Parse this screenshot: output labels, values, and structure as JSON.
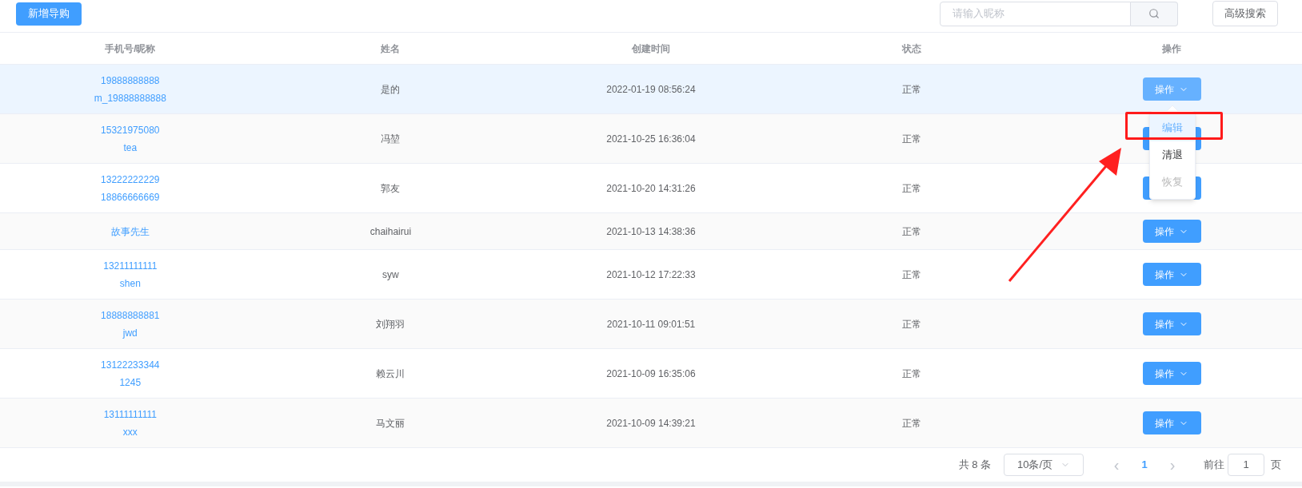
{
  "toolbar": {
    "add_button": "新增导购",
    "search": {
      "placeholder": "请输入昵称"
    },
    "advanced_button": "高级搜索"
  },
  "table": {
    "columns": [
      "手机号/昵称",
      "姓名",
      "创建时间",
      "状态",
      "操作"
    ],
    "rows": [
      {
        "contact": [
          "19888888888",
          "m_19888888888"
        ],
        "name": "是的",
        "created": "2022-01-19 08:56:24",
        "status": "正常",
        "action": "操作",
        "hovered": true
      },
      {
        "contact": [
          "15321975080",
          "tea"
        ],
        "name": "冯堃",
        "created": "2021-10-25 16:36:04",
        "status": "正常",
        "hovered": false
      },
      {
        "contact": [
          "13222222229",
          "18866666669"
        ],
        "name": "郭友",
        "created": "2021-10-20 14:31:26",
        "status": "正常",
        "hovered": false
      },
      {
        "contact": [
          "故事先生"
        ],
        "name": "chaihairui",
        "created": "2021-10-13 14:38:36",
        "status": "正常",
        "action": "操作",
        "hovered": false
      },
      {
        "contact": [
          "13211111111",
          "shen"
        ],
        "name": "syw",
        "created": "2021-10-12 17:22:33",
        "status": "正常",
        "action": "操作",
        "hovered": false
      },
      {
        "contact": [
          "18888888881",
          "jwd"
        ],
        "name": "刘翔羽",
        "created": "2021-10-11 09:01:51",
        "status": "正常",
        "action": "操作",
        "hovered": false
      },
      {
        "contact": [
          "13122233344",
          "1245"
        ],
        "name": "赖云川",
        "created": "2021-10-09 16:35:06",
        "status": "正常",
        "action": "操作",
        "hovered": false
      },
      {
        "contact": [
          "13111111111",
          "xxx"
        ],
        "name": "马文丽",
        "created": "2021-10-09 14:39:21",
        "status": "正常",
        "action": "操作",
        "hovered": false
      }
    ]
  },
  "dropdown": {
    "items": [
      {
        "label": "编辑",
        "selected": true,
        "disabled": false
      },
      {
        "label": "清退",
        "selected": false,
        "disabled": false
      },
      {
        "label": "恢复",
        "selected": false,
        "disabled": true
      }
    ]
  },
  "pagination": {
    "total": "共 8 条",
    "page_size": "10条/页",
    "prev": "‹",
    "pages": [
      {
        "label": "1",
        "selected": true
      }
    ],
    "next": "›",
    "goto_label": "前往",
    "goto_value": "1",
    "goto_suffix": "页"
  }
}
